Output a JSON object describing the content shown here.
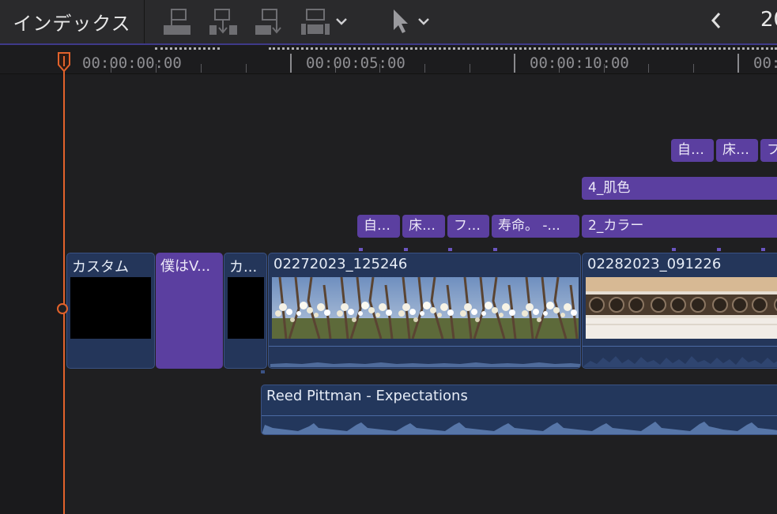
{
  "toolbar": {
    "index_label": "インデックス",
    "timecode_partial": "20"
  },
  "ruler": {
    "labels": [
      "00:00:00:00",
      "00:00:05:00",
      "00:00:10:00",
      "00:0"
    ]
  },
  "titles": {
    "row1": [
      "自…",
      "床…",
      "フ"
    ],
    "row2": [
      "4_肌色"
    ],
    "row3": [
      "自…",
      "床…",
      "フ…",
      "寿命。 -...",
      "2_カラー"
    ]
  },
  "clips": {
    "custom": "カスタム",
    "boku": "僕はV...",
    "ka": "カ...",
    "clip1": "02272023_125246",
    "clip2": "02282023_091226"
  },
  "audio": {
    "name": "Reed Pittman - Expectations"
  },
  "colors": {
    "playhead": "#e2622b",
    "title_purple": "#5b3fa0",
    "clip_blue": "#24365a",
    "toolbar_bg": "#2a2a2c"
  },
  "icons": [
    "connect-clip-icon",
    "insert-clip-icon",
    "append-clip-icon",
    "overwrite-clip-icon",
    "select-tool-icon",
    "chevron-down-icon",
    "back-arrow-icon",
    "playhead-icon"
  ]
}
